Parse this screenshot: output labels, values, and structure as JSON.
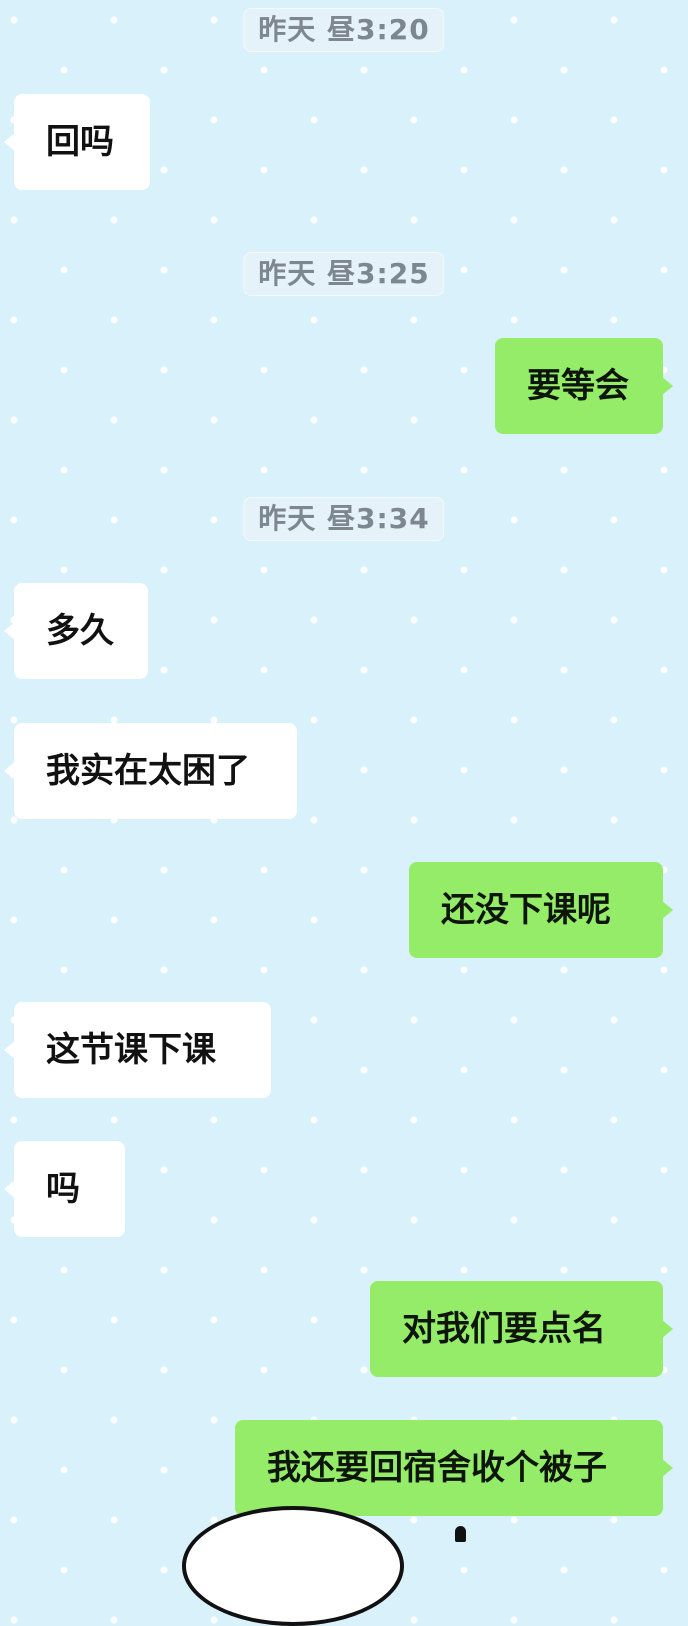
{
  "theme": {
    "background": "#d9f1fb",
    "incoming_bubble": "#ffffff",
    "outgoing_bubble": "#95ec69",
    "timestamp_text": "#7d8790"
  },
  "messages": [
    {
      "type": "timestamp",
      "text": "昨天 昼3:20"
    },
    {
      "type": "incoming",
      "text": "回吗"
    },
    {
      "type": "timestamp",
      "text": "昨天 昼3:25"
    },
    {
      "type": "outgoing",
      "text": "要等会"
    },
    {
      "type": "timestamp",
      "text": "昨天 昼3:34"
    },
    {
      "type": "incoming",
      "text": "多久"
    },
    {
      "type": "incoming",
      "text": "我实在太困了"
    },
    {
      "type": "outgoing",
      "text": "还没下课呢"
    },
    {
      "type": "incoming",
      "text": "这节课下课"
    },
    {
      "type": "incoming",
      "text": "吗"
    },
    {
      "type": "outgoing",
      "text": "对我们要点名"
    },
    {
      "type": "outgoing",
      "text": "我还要回宿舍收个被子"
    }
  ]
}
